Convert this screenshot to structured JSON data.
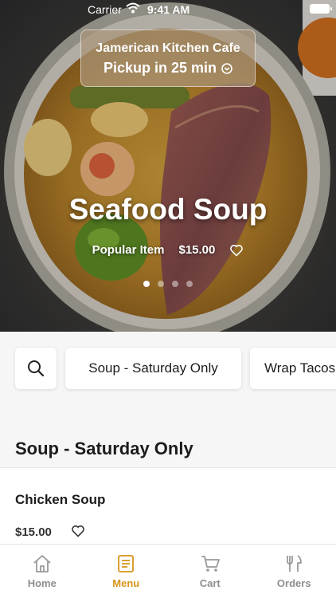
{
  "status_bar": {
    "carrier": "Carrier",
    "time": "9:41 AM"
  },
  "restaurant": {
    "name": "Jamerican Kitchen Cafe",
    "pickup": "Pickup in 25 min"
  },
  "featured": {
    "title": "Seafood Soup",
    "tag": "Popular Item",
    "price": "$15.00",
    "carousel_pages": 4,
    "carousel_active": 0
  },
  "categories": [
    "Soup - Saturday Only",
    "Wrap Tacos"
  ],
  "section": {
    "title": "Soup - Saturday Only"
  },
  "items": [
    {
      "name": "Chicken Soup",
      "price": "$15.00"
    }
  ],
  "tabs": [
    {
      "label": "Home",
      "icon": "home-icon"
    },
    {
      "label": "Menu",
      "icon": "menu-icon",
      "active": true
    },
    {
      "label": "Cart",
      "icon": "cart-icon"
    },
    {
      "label": "Orders",
      "icon": "orders-icon"
    }
  ],
  "colors": {
    "accent": "#d8931a",
    "tab_inactive": "#8e8e8e"
  }
}
